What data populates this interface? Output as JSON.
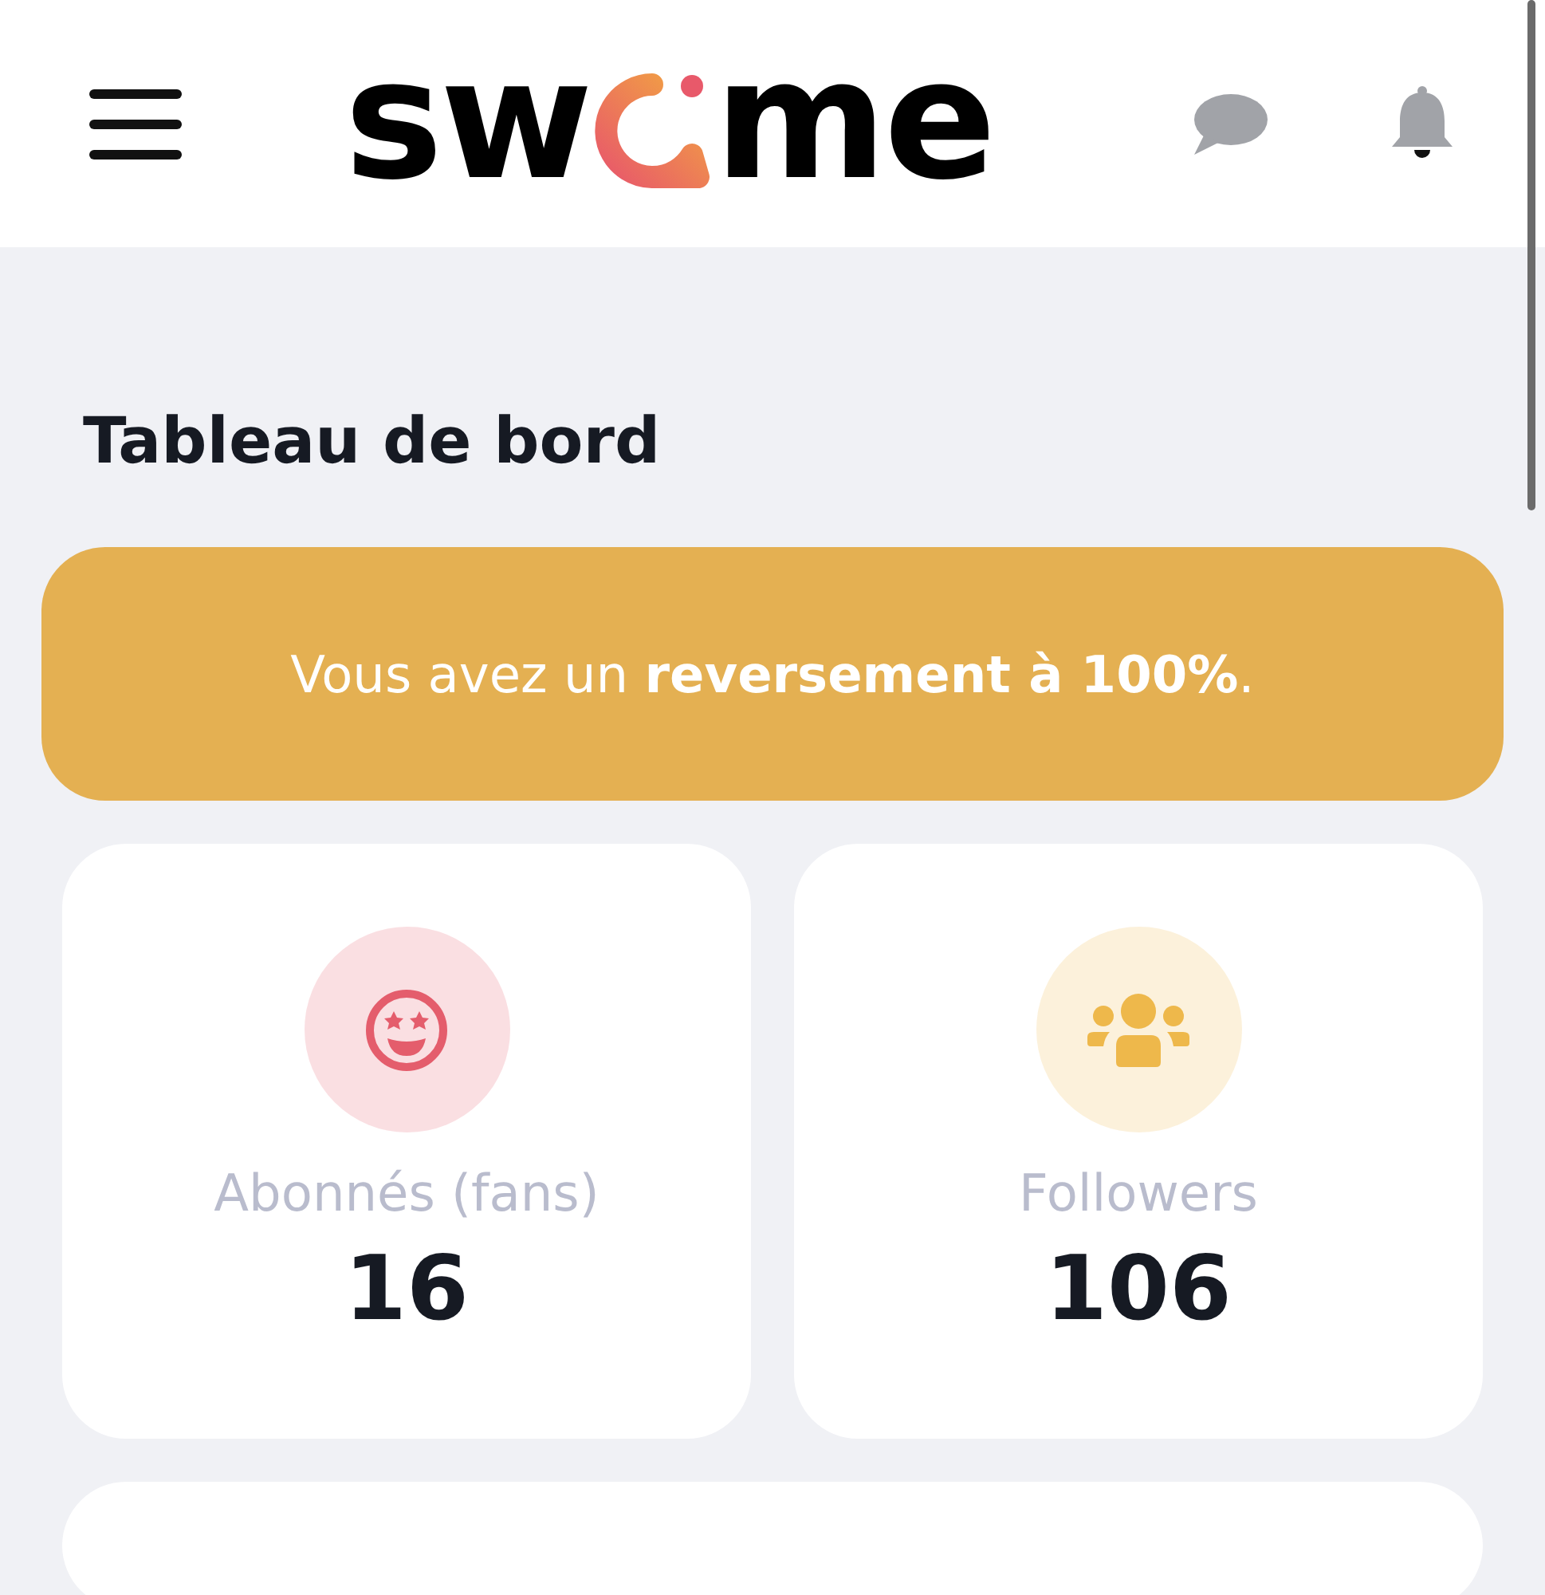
{
  "header": {
    "logo_start": "sw",
    "logo_end": "me"
  },
  "page_title": "Tableau de bord",
  "banner": {
    "text": "Vous avez un **reversement à 100%**."
  },
  "stats": [
    {
      "kind": "fans",
      "label": "Abonnés (fans)",
      "value": "16",
      "color": "#e45d6c"
    },
    {
      "kind": "followers",
      "label": "Followers",
      "value": "106",
      "color": "#eeb84b"
    }
  ]
}
